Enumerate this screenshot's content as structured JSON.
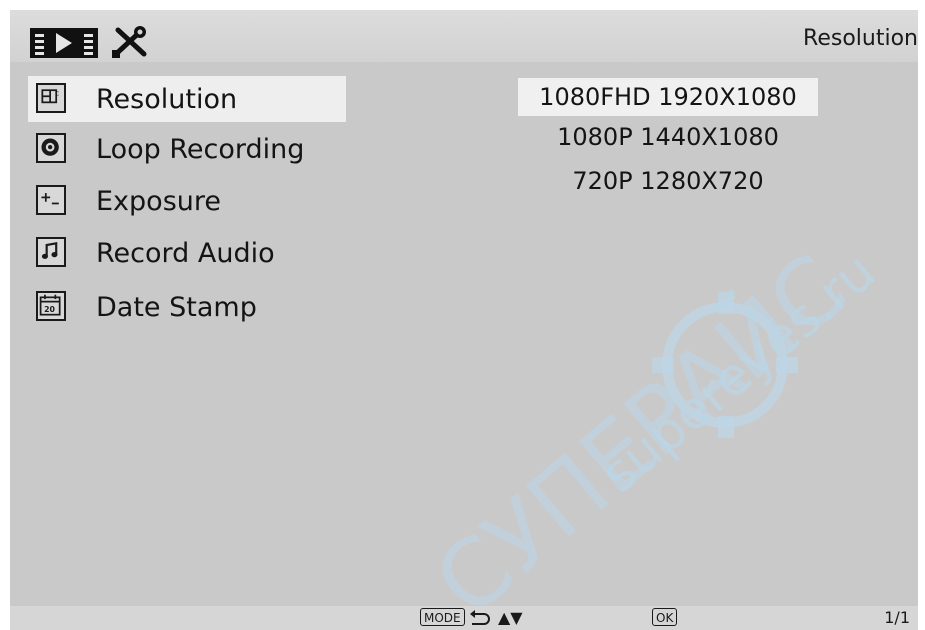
{
  "header": {
    "title": "Resolution",
    "tabs": [
      {
        "name": "video-mode",
        "icon": "film-play-icon",
        "selected": true
      },
      {
        "name": "settings",
        "icon": "tools-icon",
        "selected": false
      }
    ]
  },
  "menu": {
    "items": [
      {
        "label": "Resolution",
        "icon": "resolution-icon",
        "selected": true
      },
      {
        "label": "Loop Recording",
        "icon": "loop-recording-icon",
        "selected": false
      },
      {
        "label": "Exposure",
        "icon": "exposure-icon",
        "selected": false
      },
      {
        "label": "Record Audio",
        "icon": "music-note-icon",
        "selected": false
      },
      {
        "label": "Date Stamp",
        "icon": "calendar-icon",
        "selected": false,
        "icon_text": "20"
      }
    ]
  },
  "options": {
    "items": [
      {
        "label": "1080FHD 1920X1080",
        "selected": true
      },
      {
        "label": "1080P 1440X1080",
        "selected": false
      },
      {
        "label": "720P  1280X720",
        "selected": false
      }
    ]
  },
  "footer": {
    "mode_key": "MODE",
    "back_icon": "back-arrow-icon",
    "nav_glyph": "▲▼",
    "ok_key": "OK",
    "page_indicator": "1/1"
  },
  "watermark": {
    "text_latin": "supereyes.ru",
    "text_cyrillic": "СУПЕРАЙС"
  },
  "colors": {
    "screen_bg": "#c9c9c9",
    "selected_bg": "#eeeeee",
    "watermark": "#bcd6e6"
  }
}
